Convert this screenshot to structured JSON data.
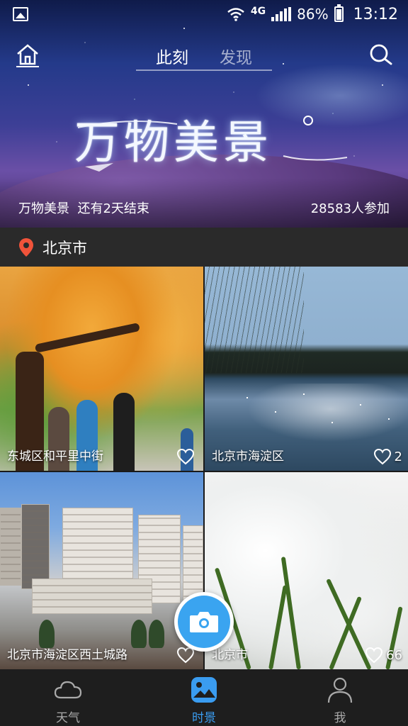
{
  "status_bar": {
    "network": "4G",
    "battery": "86%",
    "time": "13:12"
  },
  "top_nav": {
    "tabs": [
      {
        "label": "此刻",
        "active": true
      },
      {
        "label": "发现",
        "active": false
      }
    ],
    "icons": {
      "left": "home-icon",
      "right": "search-icon"
    }
  },
  "banner": {
    "title": "万物美景",
    "caption": "万物美景  还有2天结束",
    "participants": "28583人参加"
  },
  "location": {
    "label": "北京市",
    "icon": "location-pin-icon",
    "icon_color": "#f0533a"
  },
  "photos": [
    {
      "caption": "东城区和平里中街",
      "likes": ""
    },
    {
      "caption": "北京市海淀区",
      "likes": "2"
    },
    {
      "caption": "北京市海淀区西土城路",
      "likes": ""
    },
    {
      "caption": "北京市",
      "likes": "66"
    }
  ],
  "camera_button": {
    "icon": "camera-icon",
    "color": "#3aa4f0"
  },
  "bottom_nav": {
    "items": [
      {
        "label": "天气",
        "icon": "cloud-icon",
        "active": false
      },
      {
        "label": "时景",
        "icon": "picture-icon",
        "active": true
      },
      {
        "label": "我",
        "icon": "person-icon",
        "active": false
      }
    ],
    "active_color": "#3a9cf0"
  }
}
